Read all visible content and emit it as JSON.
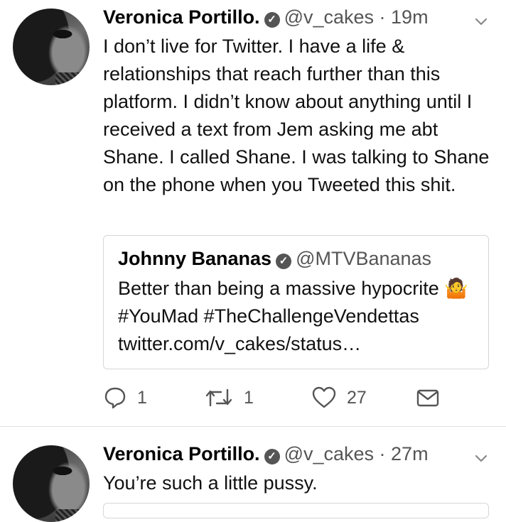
{
  "tweets": [
    {
      "name": "Veronica Portillo.",
      "handle": "@v_cakes",
      "time": "· 19m",
      "text": "I don’t live for Twitter. I have a life & relationships that reach further than this platform. I didn’t know about anything until I received a text from Jem asking me abt Shane. I called Shane. I was talking to Shane on the phone when you Tweeted this shit.",
      "quote": {
        "name": "Johnny Bananas",
        "handle": "@MTVBananas",
        "text": "Better than being a massive hypocrite 🤷 #YouMad #TheChallengeVendettas twitter.com/v_cakes/status…"
      },
      "actions": {
        "replies": "1",
        "retweets": "1",
        "likes": "27"
      }
    },
    {
      "name": "Veronica Portillo.",
      "handle": "@v_cakes",
      "time": "· 27m",
      "text": "You’re such a little pussy."
    }
  ],
  "icons": {
    "verified": "verified-badge-icon",
    "menu": "chevron-down-icon",
    "reply": "reply-icon",
    "retweet": "retweet-icon",
    "like": "heart-icon",
    "dm": "envelope-icon"
  }
}
